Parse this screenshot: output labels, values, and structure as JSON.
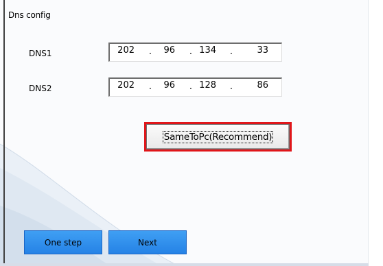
{
  "section": {
    "title": "Dns config"
  },
  "dns1": {
    "label": "DNS1",
    "octets": [
      "202",
      "96",
      "134",
      "33"
    ]
  },
  "dns2": {
    "label": "DNS2",
    "octets": [
      "202",
      "96",
      "128",
      "86"
    ]
  },
  "separator": ".",
  "buttons": {
    "same_to_pc": "SameToPc(Recommend)",
    "one_step": "One step",
    "next": "Next"
  },
  "colors": {
    "highlight_border": "#e0161a",
    "primary_button": "#2f8ff0"
  }
}
